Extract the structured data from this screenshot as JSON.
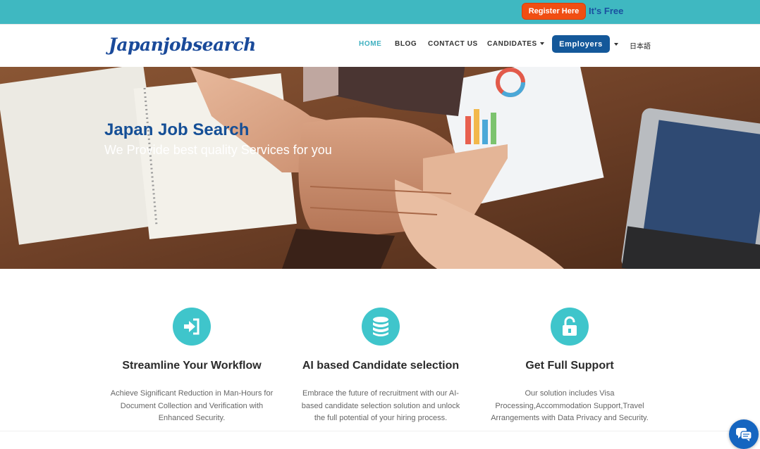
{
  "topbar": {
    "register_label": "Register Here",
    "free_label": "It's Free"
  },
  "navbar": {
    "logo": "Japanjobsearch",
    "items": [
      {
        "label": "HOME",
        "active": true
      },
      {
        "label": "BLOG"
      },
      {
        "label": "CONTACT US"
      },
      {
        "label": "CANDIDATES",
        "dropdown": true
      }
    ],
    "employers_label": "Employers",
    "language_label": "日本語"
  },
  "hero": {
    "title": "Japan Job Search",
    "subtitle": "We Provide best quality Services for you"
  },
  "features": [
    {
      "icon": "sign-in-icon",
      "title": "Streamline Your Workflow",
      "text": "Achieve Significant Reduction in Man-Hours for Document Collection and Verification with Enhanced Security."
    },
    {
      "icon": "database-icon",
      "title": "AI based Candidate selection",
      "text": "Embrace the future of recruitment with our AI-based candidate selection solution and unlock the full potential of your hiring process."
    },
    {
      "icon": "unlock-icon",
      "title": "Get Full Support",
      "text": "Our solution includes Visa Processing,Accommodation Support,Travel Arrangements with Data Privacy and Security."
    }
  ],
  "colors": {
    "topbar": "#3fb8c1",
    "register": "#f04e13",
    "brand": "#154f96",
    "icon_circle": "#3fc5cb",
    "chat": "#1565c0"
  }
}
